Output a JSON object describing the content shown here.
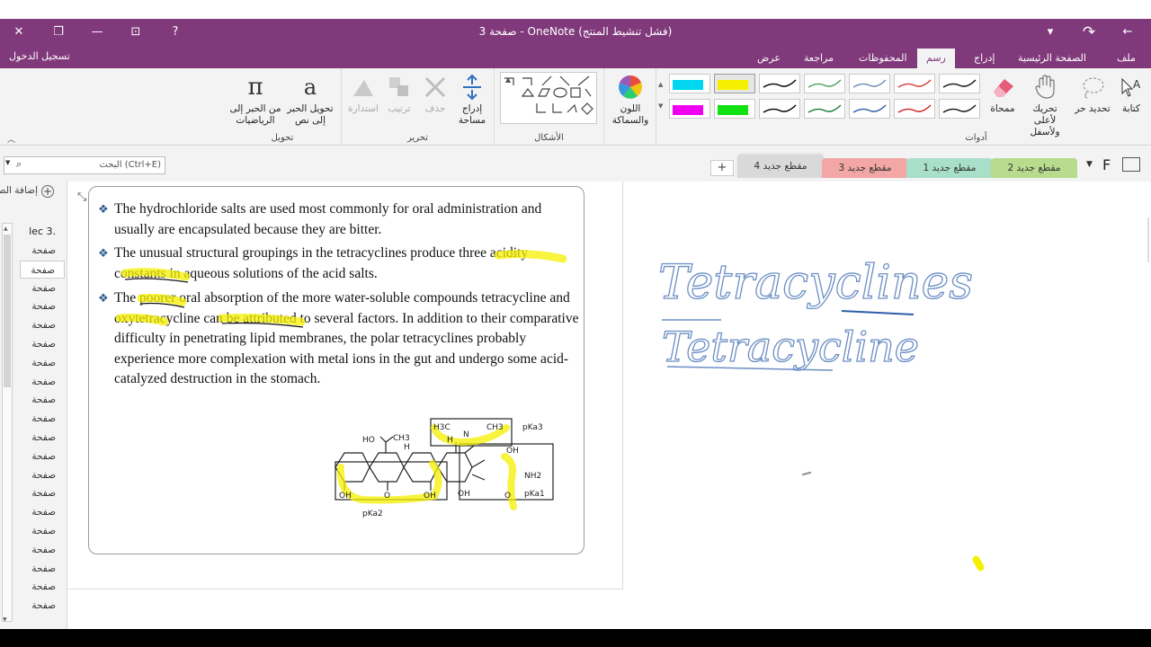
{
  "titlebar": {
    "title": "صفحة 3 - OneNote (فشل تنشيط المنتج)",
    "close_icon": "✕",
    "restore_icon": "❐",
    "minimize_icon": "—",
    "fullscreen_icon": "⊡",
    "help_icon": "?",
    "redo_icon": "↷",
    "back_icon": "←",
    "qat_icon": "▾"
  },
  "tabs": {
    "signin": "تسجيل الدخول",
    "items": [
      "ملف",
      "الصفحة الرئيسية",
      "إدراج",
      "رسم",
      "المحفوظات",
      "مراجعة",
      "عرض"
    ],
    "active": "رسم"
  },
  "ribbon": {
    "tools": {
      "type_label": "كتابة",
      "lasso_label": "تحديد حر",
      "pan_label": "تحريك لأعلى ولأسفل",
      "eraser_label": "ممحاة",
      "group_label": "أدوات"
    },
    "color_label": "اللون والسماكة",
    "shapes_group_label": "الأشكال",
    "edit": {
      "insert_space_label": "إدراج مساحة",
      "delete_label": "حذف",
      "arrange_label": "ترتيب",
      "rotate_label": "استدارة",
      "group_label": "تحرير"
    },
    "convert": {
      "ink_to_text_label": "تحويل الحبر إلى نص",
      "ink_to_math_label": "من الحبر إلى الرياضيات",
      "group_label": "تحويل"
    },
    "pen_colors": [
      "#00D6F0",
      "#F5F000",
      "#000000",
      "#4aa060",
      "#6a8db0",
      "#d33a3a",
      "#111111",
      "#F000F0",
      "#11E011",
      "#000000",
      "#1a7d3a",
      "#2e5ea8",
      "#cc2222",
      "#111111"
    ]
  },
  "search": {
    "placeholder": "البحث (Ctrl+E)"
  },
  "sections": {
    "items": [
      {
        "label": "مقطع جديد 4",
        "color": "#D9D9D9"
      },
      {
        "label": "مقطع جديد 3",
        "color": "#F2A6A6"
      },
      {
        "label": "مقطع جديد 1",
        "color": "#A8DFC8"
      },
      {
        "label": "مقطع جديد 2",
        "color": "#B8DC8E"
      }
    ],
    "add_label": "+",
    "notebook_letter": "F"
  },
  "pages": {
    "add_label": "إضافة الصـ",
    "first": "lec 3.",
    "items": [
      "صفحة",
      "صفحة",
      "صفحة",
      "صفحة",
      "صفحة",
      "صفحة",
      "صفحة",
      "صفحة",
      "صفحة",
      "صفحة",
      "صفحة",
      "صفحة",
      "صفحة",
      "صفحة",
      "صفحة",
      "صفحة",
      "صفحة",
      "صفحة",
      "صفحة",
      "صفحة"
    ],
    "selected_index": 1
  },
  "note": {
    "bullets": [
      "The hydrochloride salts are used most commonly for oral administration and usually are encapsulated because they are bitter.",
      "The unusual structural groupings in the tetracyclines produce three acidity constants in aqueous solutions of the acid salts.",
      "The poorer oral absorption of the more water-soluble compounds tetracycline and oxytetracycline can be attributed to several factors. In addition to their comparative difficulty in penetrating lipid membranes, the polar tetracyclines probably experience more complexation with metal ions in the gut and undergo some acid-catalyzed destruction in the stomach."
    ],
    "bullet_mark": "❖",
    "structure": {
      "ho": "HO",
      "ch3": "CH3",
      "h": "H",
      "h3c": "H3C",
      "nch3": "N",
      "ch3b": "CH3",
      "oh_top": "OH",
      "nh2": "NH2",
      "pka1": "pKa1",
      "pka2": "pKa2",
      "pka3": "pKa3",
      "oh1": "OH",
      "oh2": "OH",
      "oh3": "OH",
      "o1": "O",
      "o2": "O"
    }
  },
  "ink": {
    "word1": "Tetracyclines",
    "word2": "Tetracycline"
  }
}
